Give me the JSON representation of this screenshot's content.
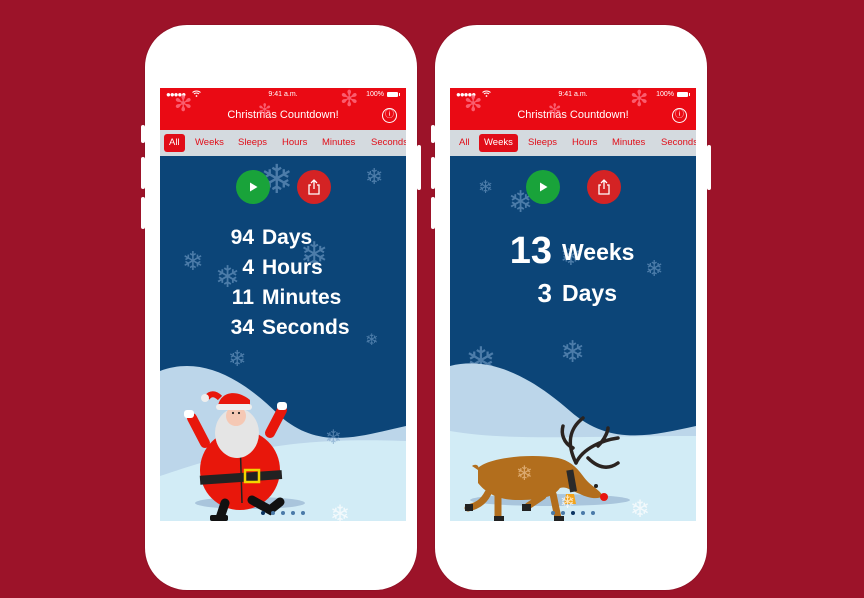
{
  "colors": {
    "background": "#9c1329",
    "header_red": "#ea0a14",
    "tab_bar": "#d4dadf",
    "sky": "#0c4578",
    "play_green": "#19a33a",
    "share_red": "#d42324"
  },
  "phones": [
    {
      "status": {
        "signal": "●●●●●",
        "time": "9:41 a.m.",
        "battery": "100%"
      },
      "nav": {
        "title": "Christmas Countdown!",
        "info_icon": "ⓘ"
      },
      "tabs": [
        "All",
        "Weeks",
        "Sleeps",
        "Hours",
        "Minutes",
        "Seconds"
      ],
      "active_tab": "All",
      "actions": {
        "play_icon": "play-icon",
        "share_icon": "share-icon"
      },
      "countdown": [
        {
          "value": "94",
          "unit": "Days"
        },
        {
          "value": "4",
          "unit": "Hours"
        },
        {
          "value": "11",
          "unit": "Minutes"
        },
        {
          "value": "34",
          "unit": "Seconds"
        }
      ],
      "illustration": "santa-claus",
      "page_dots": {
        "count": 5,
        "active_index": 0
      }
    },
    {
      "status": {
        "signal": "●●●●●",
        "time": "9:41 a.m.",
        "battery": "100%"
      },
      "nav": {
        "title": "Christmas Countdown!",
        "info_icon": "ⓘ"
      },
      "tabs": [
        "All",
        "Weeks",
        "Sleeps",
        "Hours",
        "Minutes",
        "Seconds"
      ],
      "active_tab": "Weeks",
      "actions": {
        "play_icon": "play-icon",
        "share_icon": "share-icon"
      },
      "countdown": [
        {
          "value": "13",
          "unit": "Weeks"
        },
        {
          "value": "3",
          "unit": "Days"
        }
      ],
      "illustration": "reindeer",
      "page_dots": {
        "count": 5,
        "active_index": 2
      }
    }
  ]
}
